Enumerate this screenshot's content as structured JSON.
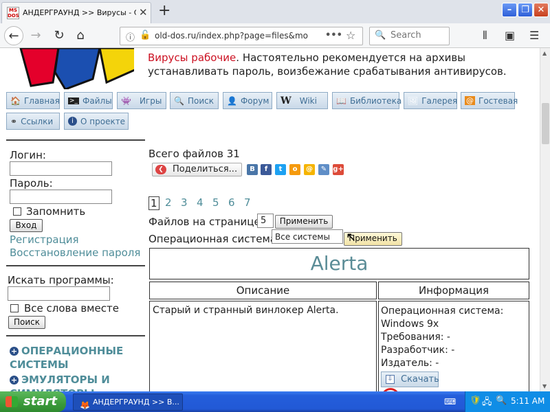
{
  "browser": {
    "tab_title": "АНДЕРГРАУНД >> Вирусы - Ста",
    "favicon_text": "MS DOS",
    "url": "old-dos.ru/index.php?page=files&mo",
    "search_placeholder": "Search"
  },
  "header": {
    "warning_red": "Вирусы рабочие",
    "warning_rest": ". Настоятельно рекомендуется на архивы устанавливать пароль, воизбежание срабатывания антивирусов."
  },
  "menu": [
    {
      "label": "Главная",
      "icon": "home-icon"
    },
    {
      "label": "Файлы",
      "icon": "terminal-icon"
    },
    {
      "label": "Игры",
      "icon": "invader-icon"
    },
    {
      "label": "Поиск",
      "icon": "search-icon"
    },
    {
      "label": "Форум",
      "icon": "user-icon"
    },
    {
      "label": "Wiki",
      "icon": "wiki-icon"
    },
    {
      "label": "Библиотека",
      "icon": "book-icon"
    },
    {
      "label": "Галерея",
      "icon": "picture-icon"
    },
    {
      "label": "Гостевая",
      "icon": "at-icon"
    },
    {
      "label": "Ссылки",
      "icon": "link-icon"
    },
    {
      "label": "О проекте",
      "icon": "info-icon"
    }
  ],
  "sidebar": {
    "login_label": "Логин:",
    "password_label": "Пароль:",
    "remember_label": "Запомнить",
    "login_button": "Вход",
    "register_link": "Регистрация",
    "restore_link": "Восстановление пароля",
    "search_label": "Искать программы:",
    "all_words_label": "Все слова вместе",
    "search_button": "Поиск",
    "categories": [
      "ОПЕРАЦИОННЫЕ СИСТЕМЫ",
      "ЭМУЛЯТОРЫ И СИМУЛЯТОРЫ"
    ]
  },
  "main": {
    "total_files": "Всего файлов 31",
    "share_label": "Поделиться...",
    "pages": [
      "1",
      "2",
      "3",
      "4",
      "5",
      "6",
      "7"
    ],
    "current_page": "1",
    "per_page_label": "Файлов на странице:",
    "per_page_value": "5",
    "apply_label": "Применить",
    "os_label": "Операционная система:",
    "os_value": "Все системы",
    "apply_label2": "Применить"
  },
  "file": {
    "title": "Alerta",
    "col_description": "Описание",
    "col_info": "Информация",
    "description": "Старый и странный винлокер Alerta.",
    "os_label": "Операционная система:",
    "os_value": "Windows 9x",
    "requirements": "Требования: -",
    "developer": "Разработчик: -",
    "publisher": "Издатель: -",
    "download_label": "Скачать"
  },
  "taskbar": {
    "start_label": "start",
    "task_label": "АНДЕРГРАУНД >> В...",
    "clock": "5:11 AM"
  },
  "colors": {
    "link": "#4f8d99",
    "warning": "#cc1122",
    "taskbar": "#245edb",
    "start": "#3a9a3a"
  }
}
